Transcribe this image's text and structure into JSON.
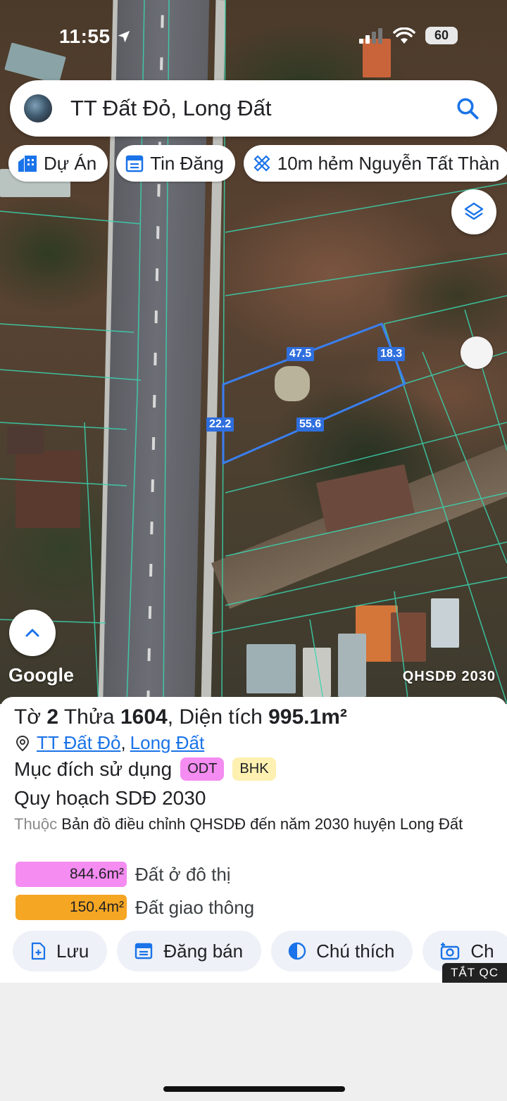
{
  "status_bar": {
    "time": "11:55",
    "battery": "60"
  },
  "search": {
    "query": "TT Đất Đỏ, Long Đất"
  },
  "chips": [
    {
      "label": "Dự Án",
      "icon": "building-icon"
    },
    {
      "label": "Tin Đăng",
      "icon": "calendar-list-icon"
    },
    {
      "label": "10m hẻm Nguyễn Tất Thàn",
      "icon": "ruler-cross-icon"
    }
  ],
  "map": {
    "parcel_edges": {
      "top": "47.5",
      "right": "18.3",
      "left": "22.2",
      "bottom": "55.6"
    },
    "attribution": "Google",
    "overlay_badge": "QHSDĐ 2030"
  },
  "info": {
    "title_prefix": "Tờ",
    "sheet": "2",
    "plot_word": "Thửa",
    "plot": "1604",
    "area_word": ", Diện tích",
    "area": "995.1m²",
    "location_1": "TT Đất Đỏ",
    "location_sep": ",",
    "location_2": "Long Đất",
    "purpose_label": "Mục đích sử dụng",
    "purpose_badges": [
      {
        "code": "ODT",
        "color": "#f48cf1"
      },
      {
        "code": "BHK",
        "color": "#fdf0b0"
      }
    ],
    "plan_label": "Quy hoạch SDĐ 2030",
    "belongs_prefix": "Thuộc",
    "belongs_text": "Bản đồ điều chỉnh QHSDĐ đến năm 2030 huyện Long Đất",
    "areas": [
      {
        "value": "844.6m²",
        "label": "Đất ở đô thị",
        "color": "#f48cf1"
      },
      {
        "value": "150.4m²",
        "label": "Đất giao thông",
        "color": "#f5a623"
      }
    ]
  },
  "actions": [
    {
      "label": "Lưu",
      "icon": "save-plus-icon"
    },
    {
      "label": "Đăng bán",
      "icon": "post-list-icon"
    },
    {
      "label": "Chú thích",
      "icon": "half-circle-icon"
    },
    {
      "label": "Ch",
      "icon": "camera-plus-icon"
    }
  ],
  "ad_toggle": "TẮT QC",
  "colors": {
    "accent": "#1a73e8",
    "parcel_line": "#2f6fde",
    "boundary_line": "#3ad6b0"
  }
}
